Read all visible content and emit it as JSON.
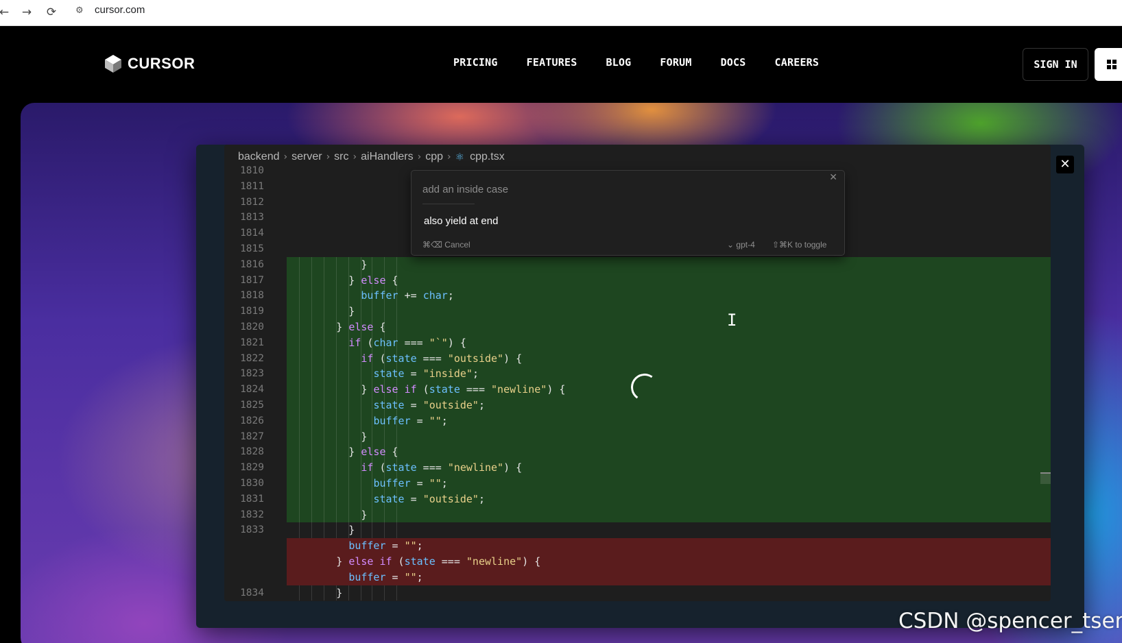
{
  "browser": {
    "back_icon": "←",
    "forward_icon": "→",
    "reload_icon": "⟳",
    "site_icon": "⚙",
    "url": "cursor.com"
  },
  "header": {
    "logo_text": "CURSOR",
    "nav": [
      "PRICING",
      "FEATURES",
      "BLOG",
      "FORUM",
      "DOCS",
      "CAREERS"
    ],
    "signin_label": "SIGN IN"
  },
  "editor": {
    "close_icon": "✕",
    "breadcrumb": [
      "backend",
      "server",
      "src",
      "aiHandlers",
      "cpp",
      "cpp.tsx"
    ],
    "breadcrumb_sep": "›",
    "file_icon": "⚛",
    "prompt": {
      "close_icon": "✕",
      "previous": "add an inside case",
      "input": "also yield at end",
      "cancel": "⌘⌫ Cancel",
      "model": "⌄ gpt-4",
      "toggle": "⇧⌘K to toggle"
    },
    "lines": [
      {
        "n": "1810",
        "t": "plain",
        "c": ""
      },
      {
        "n": "1811",
        "t": "plain",
        "c": ""
      },
      {
        "n": "1812",
        "t": "plain",
        "c": ""
      },
      {
        "n": "1813",
        "t": "plain",
        "c": ""
      },
      {
        "n": "1814",
        "t": "plain",
        "c": ""
      },
      {
        "n": "1815",
        "t": "plain",
        "c": ""
      },
      {
        "n": "1816",
        "t": "added",
        "c": "            }"
      },
      {
        "n": "1817",
        "t": "added",
        "c": "          } else {"
      },
      {
        "n": "1818",
        "t": "added",
        "c": "            buffer += char;"
      },
      {
        "n": "1819",
        "t": "added",
        "c": "          }"
      },
      {
        "n": "1820",
        "t": "added",
        "c": "        } else {"
      },
      {
        "n": "1821",
        "t": "added",
        "c": "          if (char === \"`\") {"
      },
      {
        "n": "1822",
        "t": "added",
        "c": "            if (state === \"outside\") {"
      },
      {
        "n": "1823",
        "t": "added",
        "c": "              state = \"inside\";"
      },
      {
        "n": "1824",
        "t": "added",
        "c": "            } else if (state === \"newline\") {"
      },
      {
        "n": "1825",
        "t": "added",
        "c": "              state = \"outside\";"
      },
      {
        "n": "1826",
        "t": "added",
        "c": "              buffer = \"\";"
      },
      {
        "n": "1827",
        "t": "added",
        "c": "            }"
      },
      {
        "n": "1828",
        "t": "added",
        "c": "          } else {"
      },
      {
        "n": "1829",
        "t": "added",
        "c": "            if (state === \"newline\") {"
      },
      {
        "n": "1830",
        "t": "added",
        "c": "              buffer = \"\";"
      },
      {
        "n": "1831",
        "t": "added",
        "c": "              state = \"outside\";"
      },
      {
        "n": "1832",
        "t": "added",
        "c": "            }"
      },
      {
        "n": "1833",
        "t": "plain",
        "c": "          }"
      },
      {
        "n": "",
        "t": "removed",
        "c": "          buffer = \"\";"
      },
      {
        "n": "",
        "t": "removed",
        "c": "        } else if (state === \"newline\") {"
      },
      {
        "n": "",
        "t": "removed",
        "c": "          buffer = \"\";"
      },
      {
        "n": "1834",
        "t": "plain",
        "c": "        }"
      }
    ]
  },
  "watermark": "CSDN @spencer_tseng",
  "colors": {
    "added_bg": "#1e4620",
    "removed_bg": "#5a1c1d",
    "editor_bg": "#1e1e1e"
  }
}
